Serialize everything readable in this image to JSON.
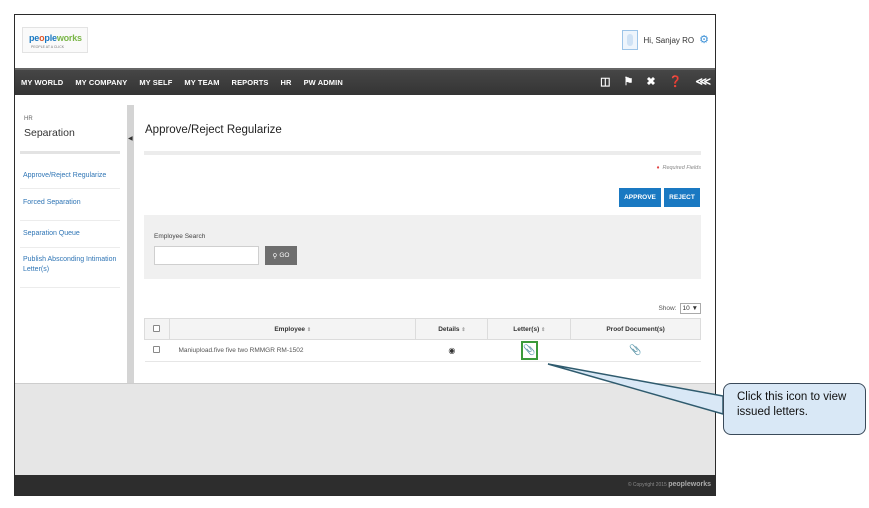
{
  "header": {
    "logo_text": "peopleworks",
    "logo_tagline": "PEOPLE AT A CLICK",
    "greeting": "Hi, Sanjay RO"
  },
  "nav": {
    "items": [
      "MY WORLD",
      "MY COMPANY",
      "MY SELF",
      "MY TEAM",
      "REPORTS",
      "HR",
      "PW ADMIN"
    ],
    "icons": [
      "book-icon",
      "flag-icon",
      "tools-icon",
      "help-icon",
      "share-icon"
    ]
  },
  "sidebar": {
    "crumb": "HR",
    "section": "Separation",
    "links": [
      "Approve/Reject Regularize",
      "Forced Separation",
      "Separation Queue",
      "Publish Absconding Intimation Letter(s)"
    ]
  },
  "main": {
    "title": "Approve/Reject Regularize",
    "required_note": "Required Fields",
    "approve_label": "APPROVE",
    "reject_label": "REJECT",
    "search_label": "Employee Search",
    "search_value": "",
    "go_label": "GO",
    "show_label": "Show:",
    "show_value": "10"
  },
  "table": {
    "headers": [
      "Employee",
      "Details",
      "Letter(s)",
      "Proof Document(s)"
    ],
    "rows": [
      {
        "employee": "Maniupload.five five two RMMGR RM-1502"
      }
    ]
  },
  "footer": {
    "copyright": "© Copyright 2015",
    "brand": "peopleworks"
  },
  "callout": {
    "text": "Click this icon to view issued letters."
  },
  "colors": {
    "accent": "#1a79c2",
    "nav_bg": "#3b3b3b",
    "highlight": "#3a9a3a",
    "callout_bg": "#d9e8f6"
  }
}
